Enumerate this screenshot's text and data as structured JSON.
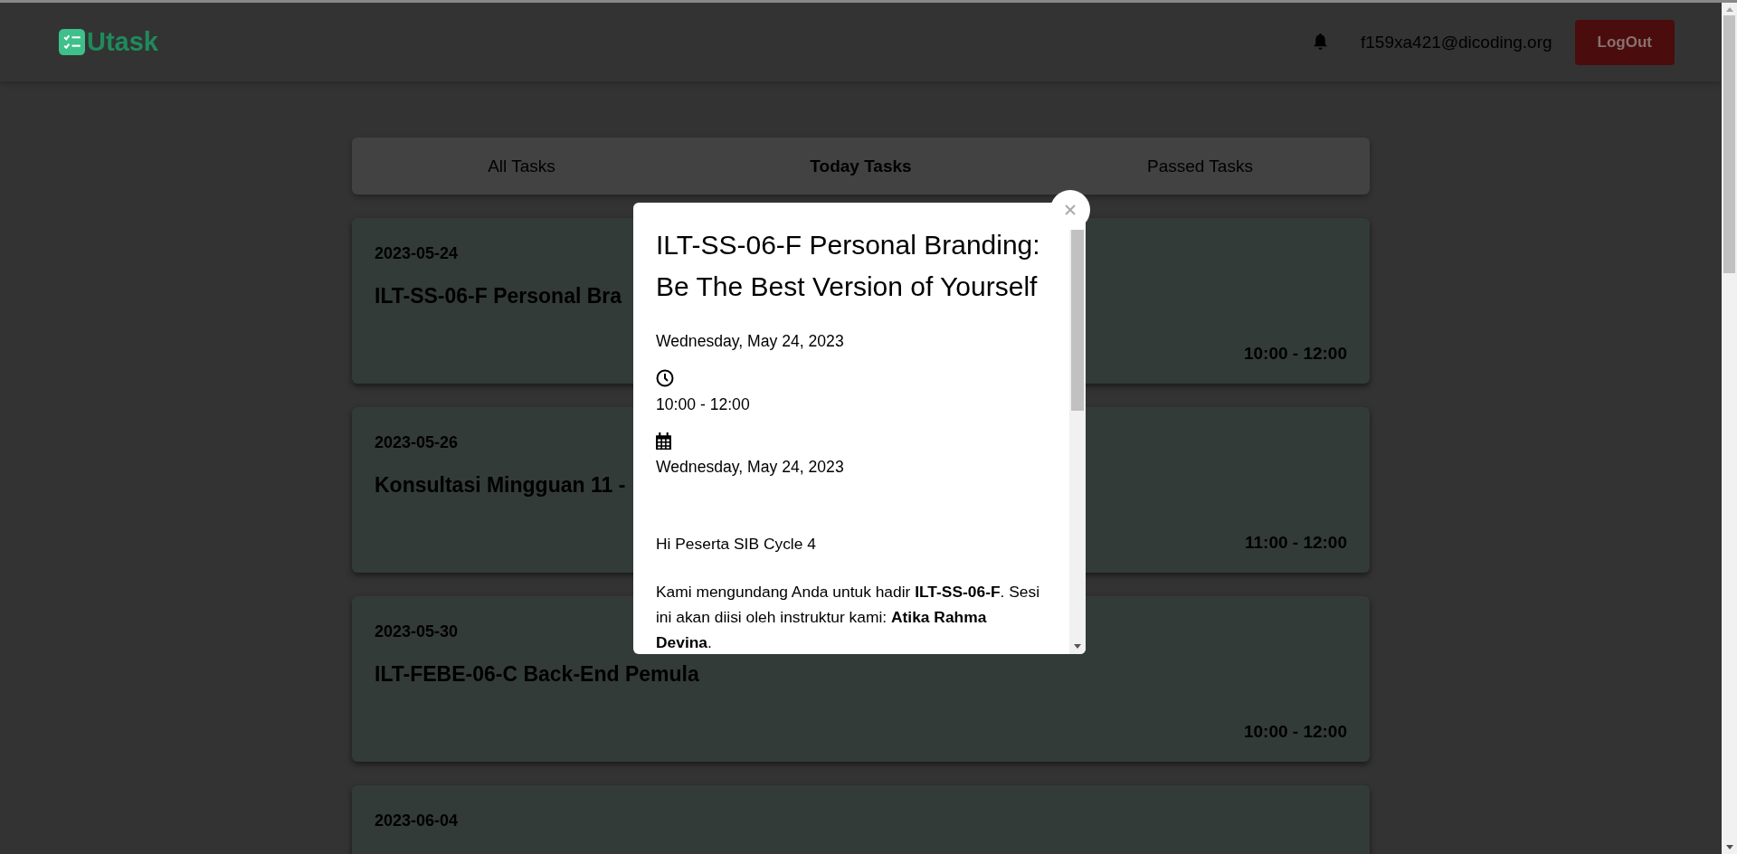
{
  "header": {
    "logo": "Utask",
    "user_email": "f159xa421@dicoding.org",
    "logout_button": "LogOut"
  },
  "tabs": [
    {
      "label": "All Tasks",
      "selected": false
    },
    {
      "label": "Today Tasks",
      "selected": true
    },
    {
      "label": "Passed Tasks",
      "selected": false
    }
  ],
  "tasks": [
    {
      "date": "2023-05-24",
      "title": "ILT-SS-06-F Personal Bra",
      "time": "10:00 - 12:00"
    },
    {
      "date": "2023-05-26",
      "title": "Konsultasi Mingguan 11 -",
      "time": "11:00 - 12:00"
    },
    {
      "date": "2023-05-30",
      "title": "ILT-FEBE-06-C Back-End Pemula",
      "time": "10:00 - 12:00"
    },
    {
      "date": "2023-06-04"
    }
  ],
  "modal": {
    "title": "ILT-SS-06-F Personal Branding: Be The Best Version of Yourself",
    "date": "Wednesday, May 24, 2023",
    "time": "10:00 - 12:00",
    "calendar_date": "Wednesday, May 24, 2023",
    "paragraphs": [
      "Hi Peserta SIB Cycle 4",
      "Kami mengundang Anda untuk hadir **ILT-SS-06-F**. Sesi ini akan diisi oleh instruktur kami: **Atika Rahma Devina**."
    ]
  }
}
